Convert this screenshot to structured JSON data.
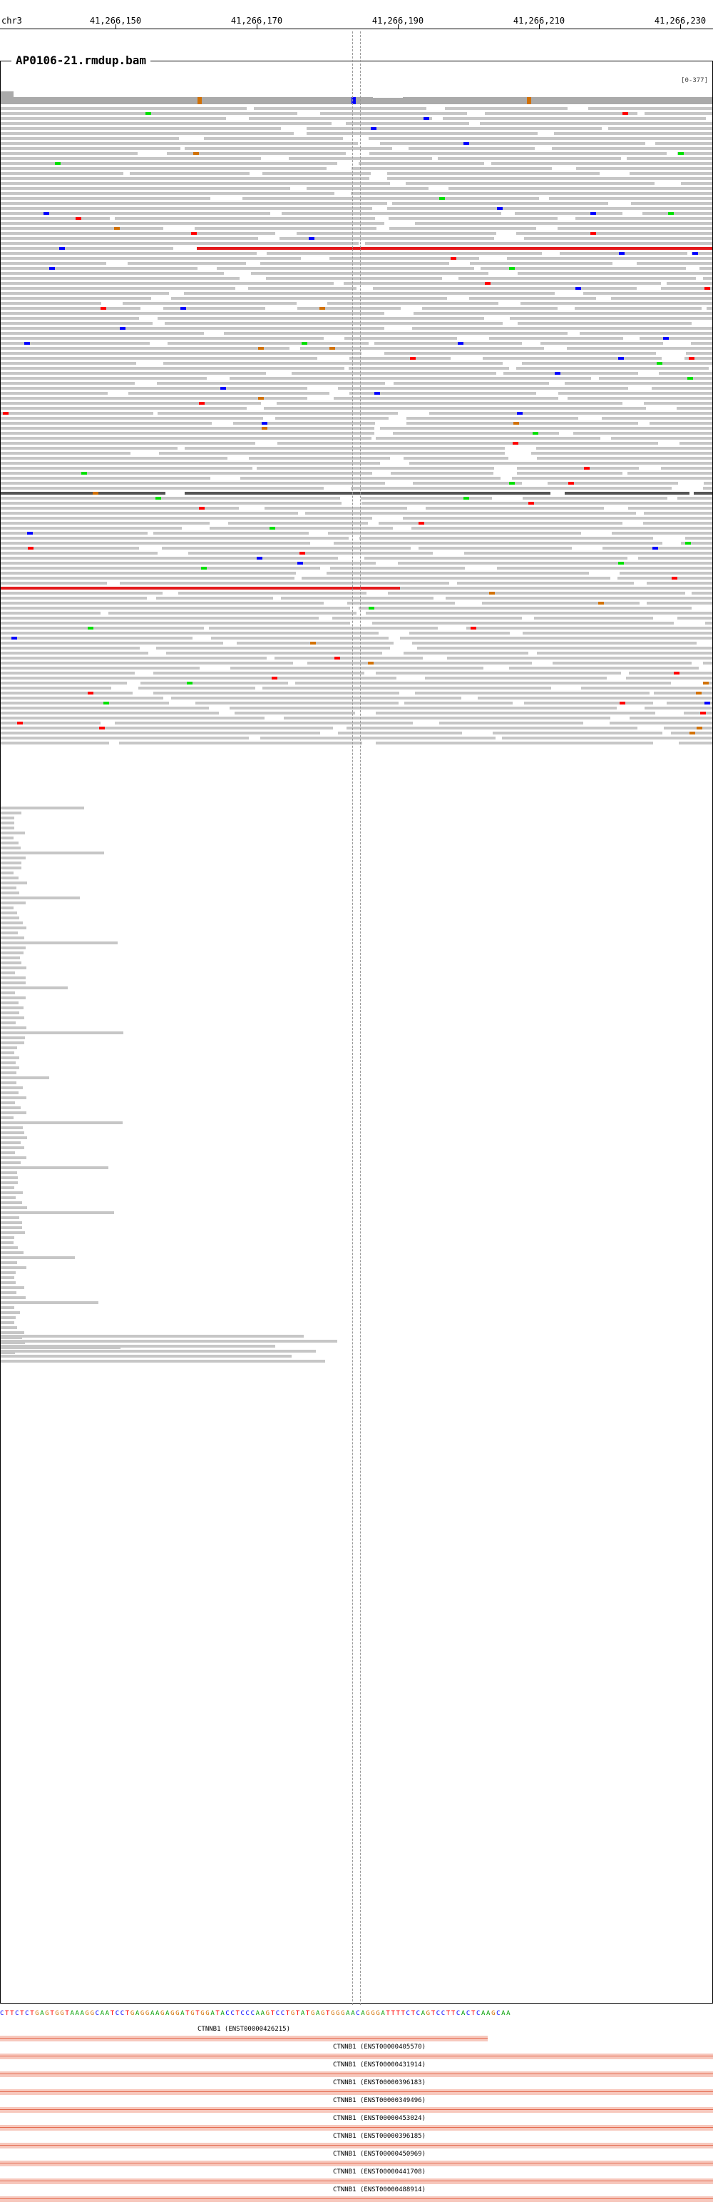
{
  "ruler": {
    "chromosome": "chr3",
    "ticks": [
      "41,266,150",
      "41,266,170",
      "41,266,190",
      "41,266,210",
      "41,266,230"
    ]
  },
  "track": {
    "title": "AP0106-21.rmdup.bam",
    "data_range": "[0-377]"
  },
  "reference_sequence": "CTTCTCTGAGTGGTAAAGGCAATCCTGAGGAAGAGGATGTGGATACCTCCCAAGTCCTGTATGAGTGGGAACAGGGATTTTCTCAGTCCTTCACTCAAGCAA",
  "genes": [
    {
      "label": "CTNNB1 (ENST00000426215)"
    },
    {
      "label": "CTNNB1 (ENST00000405570)"
    },
    {
      "label": "CTNNB1 (ENST00000431914)"
    },
    {
      "label": "CTNNB1 (ENST00000396183)"
    },
    {
      "label": "CTNNB1 (ENST00000349496)"
    },
    {
      "label": "CTNNB1 (ENST00000453024)"
    },
    {
      "label": "CTNNB1 (ENST00000396185)"
    },
    {
      "label": "CTNNB1 (ENST00000450969)"
    },
    {
      "label": "CTNNB1 (ENST00000441708)"
    },
    {
      "label": "CTNNB1 (ENST00000488914)"
    }
  ],
  "colors": {
    "read": "#c6c6c6",
    "mismatch_a": "#00e000",
    "mismatch_c": "#0000ff",
    "mismatch_g": "#d17105",
    "mismatch_t": "#ff0000",
    "gene": "#f7c8bd"
  }
}
